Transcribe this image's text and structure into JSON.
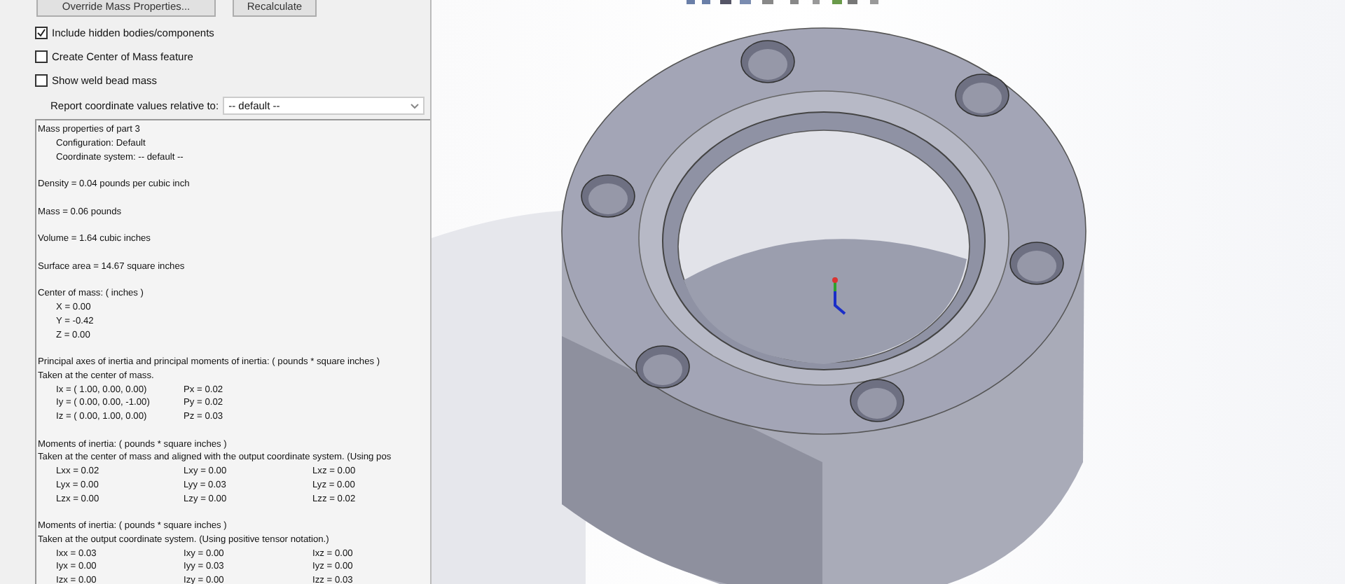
{
  "buttons": [
    "Override Mass Properties...",
    "Recalculate"
  ],
  "options": [
    {
      "label": "Include hidden bodies/components",
      "checked": true
    },
    {
      "label": "Create Center of Mass feature",
      "checked": false
    },
    {
      "label": "Show weld bead mass",
      "checked": false
    }
  ],
  "report_relative": {
    "label": "Report coordinate values relative to:",
    "value": "-- default --"
  },
  "results": [
    [
      {
        "text": "Mass properties of part 3",
        "children": [
          {
            "cells": [
              "Configuration: Default"
            ]
          },
          {
            "cells": [
              "Coordinate system: -- default --"
            ]
          }
        ]
      }
    ],
    [
      {
        "text": "Density = 0.04 pounds per cubic inch"
      }
    ],
    [
      {
        "text": "Mass = 0.06 pounds"
      }
    ],
    [
      {
        "text": "Volume = 1.64 cubic inches"
      }
    ],
    [
      {
        "text": "Surface area = 14.67 square inches"
      }
    ],
    [
      {
        "text": "Center of mass: ( inches )",
        "children": [
          {
            "cells": [
              "X = 0.00"
            ]
          },
          {
            "cells": [
              "Y = -0.42"
            ]
          },
          {
            "cells": [
              "Z = 0.00"
            ]
          }
        ]
      }
    ],
    [
      {
        "text": "Principal axes of inertia and principal moments of inertia: ( pounds * square inches )"
      },
      {
        "text": "Taken at the center of mass.",
        "children": [
          {
            "cells": [
              "Ix = ( 1.00,  0.00,  0.00)",
              "Px = 0.02"
            ]
          },
          {
            "cells": [
              "Iy = ( 0.00,  0.00, -1.00)",
              "Py = 0.02"
            ]
          },
          {
            "cells": [
              "Iz = ( 0.00,  1.00,  0.00)",
              "Pz = 0.03"
            ]
          }
        ]
      }
    ],
    [
      {
        "text": "Moments of inertia: ( pounds * square inches )"
      },
      {
        "text": "Taken at the center of mass and aligned with the output coordinate system. (Using pos",
        "children": [
          {
            "cells": [
              "Lxx = 0.02",
              "Lxy = 0.00",
              "Lxz = 0.00"
            ]
          },
          {
            "cells": [
              "Lyx = 0.00",
              "Lyy = 0.03",
              "Lyz = 0.00"
            ]
          },
          {
            "cells": [
              "Lzx = 0.00",
              "Lzy = 0.00",
              "Lzz = 0.02"
            ]
          }
        ]
      }
    ],
    [
      {
        "text": "Moments of inertia: ( pounds * square inches )"
      },
      {
        "text": "Taken at the output coordinate system. (Using positive tensor notation.)",
        "children": [
          {
            "cells": [
              "Ixx = 0.03",
              "Ixy = 0.00",
              "Ixz = 0.00"
            ]
          },
          {
            "cells": [
              "Iyx = 0.00",
              "Iyy = 0.03",
              "Iyz = 0.00"
            ]
          },
          {
            "cells": [
              "Izx = 0.00",
              "Izy = 0.00",
              "Izz = 0.03"
            ]
          }
        ]
      }
    ]
  ]
}
